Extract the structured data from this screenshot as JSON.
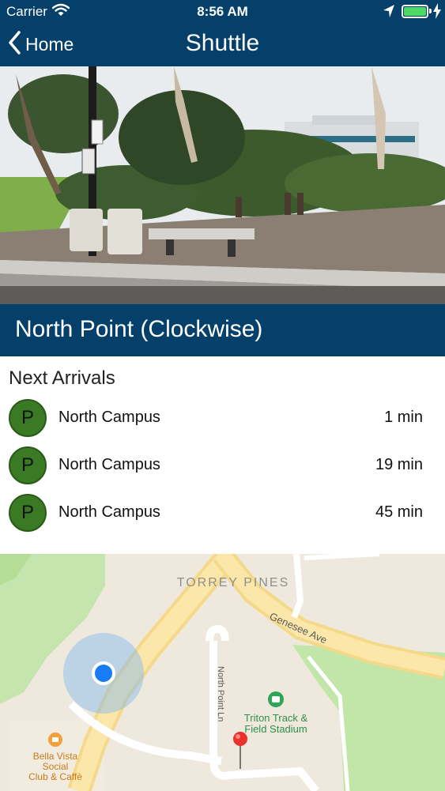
{
  "status_bar": {
    "carrier": "Carrier",
    "time": "8:56 AM",
    "icons": [
      "wifi-icon",
      "location-arrow-icon",
      "battery-icon",
      "charging-bolt-icon"
    ],
    "battery_color": "#4cd964"
  },
  "nav": {
    "back_label": "Home",
    "title": "Shuttle",
    "bar_color": "#05406b"
  },
  "stop": {
    "name": "North Point (Clockwise)"
  },
  "arrivals": {
    "heading": "Next Arrivals",
    "badge_color": "#3b7a24",
    "items": [
      {
        "route": "P",
        "destination": "North Campus",
        "eta": "1 min"
      },
      {
        "route": "P",
        "destination": "North Campus",
        "eta": "19 min"
      },
      {
        "route": "P",
        "destination": "North Campus",
        "eta": "45 min"
      }
    ]
  },
  "map": {
    "labels": {
      "area": "TORREY PINES",
      "street_genesee": "Genesee Ave",
      "street_northpoint": "North Point Ln",
      "poi_stadium_line1": "Triton Track &",
      "poi_stadium_line2": "Field Stadium",
      "poi_cafe_line1": "Bella Vista",
      "poi_cafe_line2": "Social",
      "poi_cafe_line3": "Club & Caffè"
    }
  }
}
